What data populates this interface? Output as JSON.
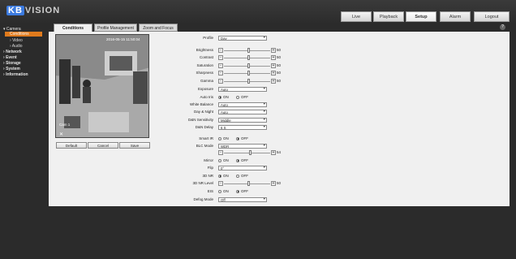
{
  "brand": {
    "prefix": "KB",
    "name": "VISION"
  },
  "top_nav": [
    {
      "label": "Live"
    },
    {
      "label": "Playback"
    },
    {
      "label": "Setup",
      "active": true
    },
    {
      "label": "Alarm"
    },
    {
      "label": "Logout"
    }
  ],
  "sidebar": {
    "camera": "Camera",
    "conditions": "Conditions",
    "video": "Video",
    "audio": "Audio",
    "network": "Network",
    "event": "Event",
    "storage": "Storage",
    "system": "System",
    "information": "Information"
  },
  "tabs": {
    "conditions": "Conditions",
    "profile": "Profile Management",
    "zoom": "Zoom and Focus"
  },
  "help_icon": "?",
  "video": {
    "timestamp": "2016-05-15 11:50:04",
    "cam_label": "Cam 1",
    "x_icon": "✕"
  },
  "buttons": {
    "default": "Default",
    "cancel": "Cancel",
    "save": "Save"
  },
  "form": {
    "profile": {
      "label": "Profile",
      "value": "Day"
    },
    "brightness": {
      "label": "Brightness",
      "value": 50
    },
    "contrast": {
      "label": "Contrast",
      "value": 50
    },
    "saturation": {
      "label": "Saturation",
      "value": 50
    },
    "sharpness": {
      "label": "Sharpness",
      "value": 50
    },
    "gamma": {
      "label": "Gamma",
      "value": 50
    },
    "exposure": {
      "label": "Exposure",
      "value": "Auto"
    },
    "auto_iris": {
      "label": "Auto Iris",
      "on": "ON",
      "off": "OFF",
      "selected": "ON"
    },
    "white_balance": {
      "label": "White Balance",
      "value": "Auto"
    },
    "day_night": {
      "label": "Day & Night",
      "value": "Auto"
    },
    "dn_sensitivity": {
      "label": "D&N Sensitivity",
      "value": "Middle"
    },
    "dn_delay": {
      "label": "D&N Delay",
      "value": "6 S"
    },
    "smart_ir": {
      "label": "Smart IR",
      "on": "ON",
      "off": "OFF",
      "selected": "OFF"
    },
    "blc_mode": {
      "label": "BLC Mode",
      "value": "WDR",
      "slider_value": 54
    },
    "mirror": {
      "label": "Mirror",
      "on": "ON",
      "off": "OFF",
      "selected": "OFF"
    },
    "flip": {
      "label": "Flip",
      "value": "0°"
    },
    "nr_3d": {
      "label": "3D NR",
      "on": "ON",
      "off": "OFF",
      "selected": "ON"
    },
    "nr_3d_level": {
      "label": "3D NR Level",
      "value": 50
    },
    "eis": {
      "label": "EIS",
      "on": "ON",
      "off": "OFF",
      "selected": "OFF"
    },
    "defog_mode": {
      "label": "Defog Mode",
      "value": "Off"
    }
  }
}
